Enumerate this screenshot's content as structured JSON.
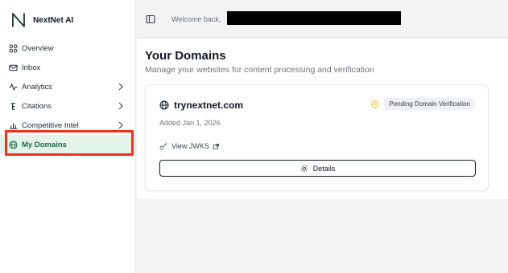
{
  "brand": {
    "name": "NextNet AI"
  },
  "sidebar": {
    "items": [
      {
        "label": "Overview",
        "icon": "overview-icon"
      },
      {
        "label": "Inbox",
        "icon": "inbox-icon"
      },
      {
        "label": "Analytics",
        "icon": "analytics-icon",
        "expandable": true
      },
      {
        "label": "Citations",
        "icon": "citations-icon",
        "expandable": true
      },
      {
        "label": "Competitive Intel",
        "icon": "competitive-intel-icon",
        "expandable": true
      },
      {
        "label": "My Domains",
        "icon": "globe-icon",
        "active": true
      }
    ]
  },
  "header": {
    "welcome": "Welcome back,"
  },
  "main": {
    "title": "Your Domains",
    "subtitle": "Manage your websites for content processing and verification",
    "domains": [
      {
        "name": "trynextnet.com",
        "status": "Pending Domain Verification",
        "added": "Added Jan 1, 2026",
        "jwks_label": "View JWKS",
        "details_label": "Details"
      }
    ]
  },
  "colors": {
    "active_bg": "#e3f4ea",
    "active_text": "#1f6b42",
    "status_icon": "#f5b400",
    "highlight": "#f0321c"
  }
}
